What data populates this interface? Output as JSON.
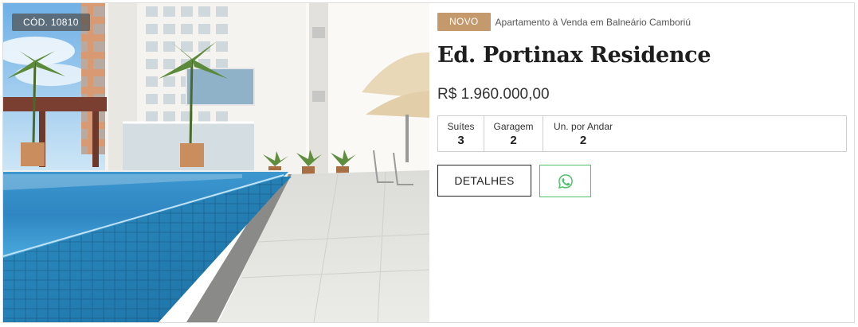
{
  "listing": {
    "code": "CÓD. 10810",
    "badge": "NOVO",
    "category": "Apartamento à Venda em Balneário Camboriú",
    "title": "Ed. Portinax Residence",
    "price": "R$ 1.960.000,00",
    "specs": [
      {
        "label": "Suítes",
        "value": "3"
      },
      {
        "label": "Garagem",
        "value": "2"
      },
      {
        "label": "Un. por Andar",
        "value": "2"
      }
    ],
    "details_button": "DETALHES",
    "whatsapp_icon": "whatsapp-icon"
  },
  "colors": {
    "badge_new": "#c49a6c",
    "whatsapp": "#4ec06a",
    "border": "#cfcfcf"
  }
}
